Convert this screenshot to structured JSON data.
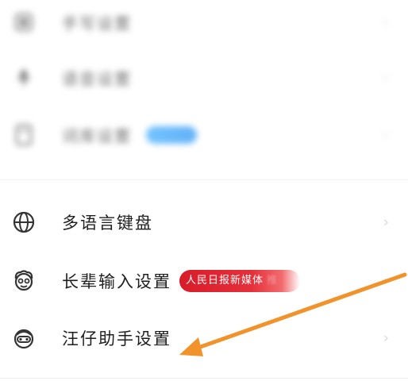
{
  "settings_list": {
    "items": [
      {
        "id": "blurred-1",
        "label": "手写设置"
      },
      {
        "id": "blurred-2",
        "label": "语音设置"
      },
      {
        "id": "blurred-3",
        "label": "词库设置"
      },
      {
        "id": "multilang",
        "label": "多语言键盘"
      },
      {
        "id": "elder",
        "label": "长辈输入设置",
        "badge": "人民日报新媒体",
        "badge_extra": "推"
      },
      {
        "id": "wangzai",
        "label": "汪仔助手设置"
      }
    ]
  },
  "colors": {
    "badge_red": "#d81c2a",
    "badge_blue": "#48a4f5",
    "arrow": "#f2922a"
  },
  "icons": {
    "multilang": "globe-icon",
    "elder": "elder-face-icon",
    "wangzai": "wangzai-face-icon"
  }
}
